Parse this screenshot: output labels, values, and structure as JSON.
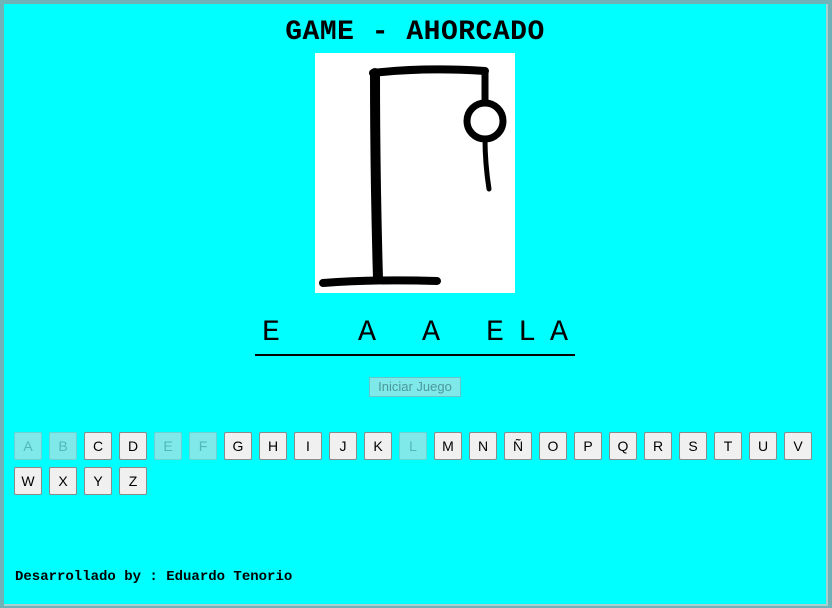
{
  "game": {
    "title": "GAME - AHORCADO",
    "word_slots": [
      "E",
      "",
      "",
      "A",
      "",
      "A",
      "",
      "E",
      "L",
      "A"
    ],
    "start_button_label": "Iniciar Juego"
  },
  "keyboard": {
    "keys": [
      {
        "letter": "A",
        "used": true
      },
      {
        "letter": "B",
        "used": true
      },
      {
        "letter": "C",
        "used": false
      },
      {
        "letter": "D",
        "used": false
      },
      {
        "letter": "E",
        "used": true
      },
      {
        "letter": "F",
        "used": true
      },
      {
        "letter": "G",
        "used": false
      },
      {
        "letter": "H",
        "used": false
      },
      {
        "letter": "I",
        "used": false
      },
      {
        "letter": "J",
        "used": false
      },
      {
        "letter": "K",
        "used": false
      },
      {
        "letter": "L",
        "used": true
      },
      {
        "letter": "M",
        "used": false
      },
      {
        "letter": "N",
        "used": false
      },
      {
        "letter": "Ñ",
        "used": false
      },
      {
        "letter": "O",
        "used": false
      },
      {
        "letter": "P",
        "used": false
      },
      {
        "letter": "Q",
        "used": false
      },
      {
        "letter": "R",
        "used": false
      },
      {
        "letter": "S",
        "used": false
      },
      {
        "letter": "T",
        "used": false
      },
      {
        "letter": "U",
        "used": false
      },
      {
        "letter": "V",
        "used": false
      },
      {
        "letter": "W",
        "used": false
      },
      {
        "letter": "X",
        "used": false
      },
      {
        "letter": "Y",
        "used": false
      },
      {
        "letter": "Z",
        "used": false
      }
    ]
  },
  "footer": {
    "credit": "Desarrollado by : Eduardo Tenorio"
  },
  "colors": {
    "background": "#00ffff",
    "used_key": "#7fe8e8",
    "key": "#f0f0f0"
  },
  "icons": {
    "hangman_drawing": "gallows-with-head-and-body"
  }
}
